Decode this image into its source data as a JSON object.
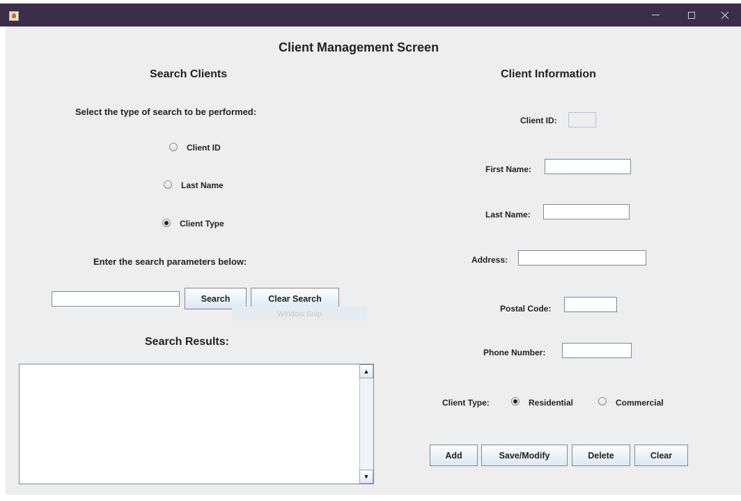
{
  "window": {
    "title": "",
    "controls": {
      "minimize": "minimize-icon",
      "maximize": "maximize-icon",
      "close": "close-icon"
    }
  },
  "main_title": "Client Management Screen",
  "search": {
    "heading": "Search Clients",
    "type_prompt": "Select the type of search to be performed:",
    "options": [
      {
        "label": "Client ID",
        "selected": false
      },
      {
        "label": "Last Name",
        "selected": false
      },
      {
        "label": "Client Type",
        "selected": true
      }
    ],
    "params_prompt": "Enter the search parameters below:",
    "query_value": "",
    "search_button": "Search",
    "clear_search_button": "Clear Search",
    "hint_overlay": "Window Snip",
    "results_heading": "Search Results:",
    "results": []
  },
  "client_info": {
    "heading": "Client Information",
    "client_id_label": "Client ID:",
    "client_id_value": "",
    "first_name_label": "First Name:",
    "first_name_value": "",
    "last_name_label": "Last Name:",
    "last_name_value": "",
    "address_label": "Address:",
    "address_value": "",
    "postal_code_label": "Postal Code:",
    "postal_code_value": "",
    "phone_label": "Phone Number:",
    "phone_value": "",
    "client_type_label": "Client Type:",
    "client_types": [
      {
        "label": "Residential",
        "selected": true
      },
      {
        "label": "Commercial",
        "selected": false
      }
    ]
  },
  "actions": {
    "add": "Add",
    "save_modify": "Save/Modify",
    "delete": "Delete",
    "clear": "Clear"
  },
  "colors": {
    "titlebar": "#3a2e4b",
    "panel": "#eeeeee",
    "button_gradient_bottom": "#dde8f3"
  }
}
